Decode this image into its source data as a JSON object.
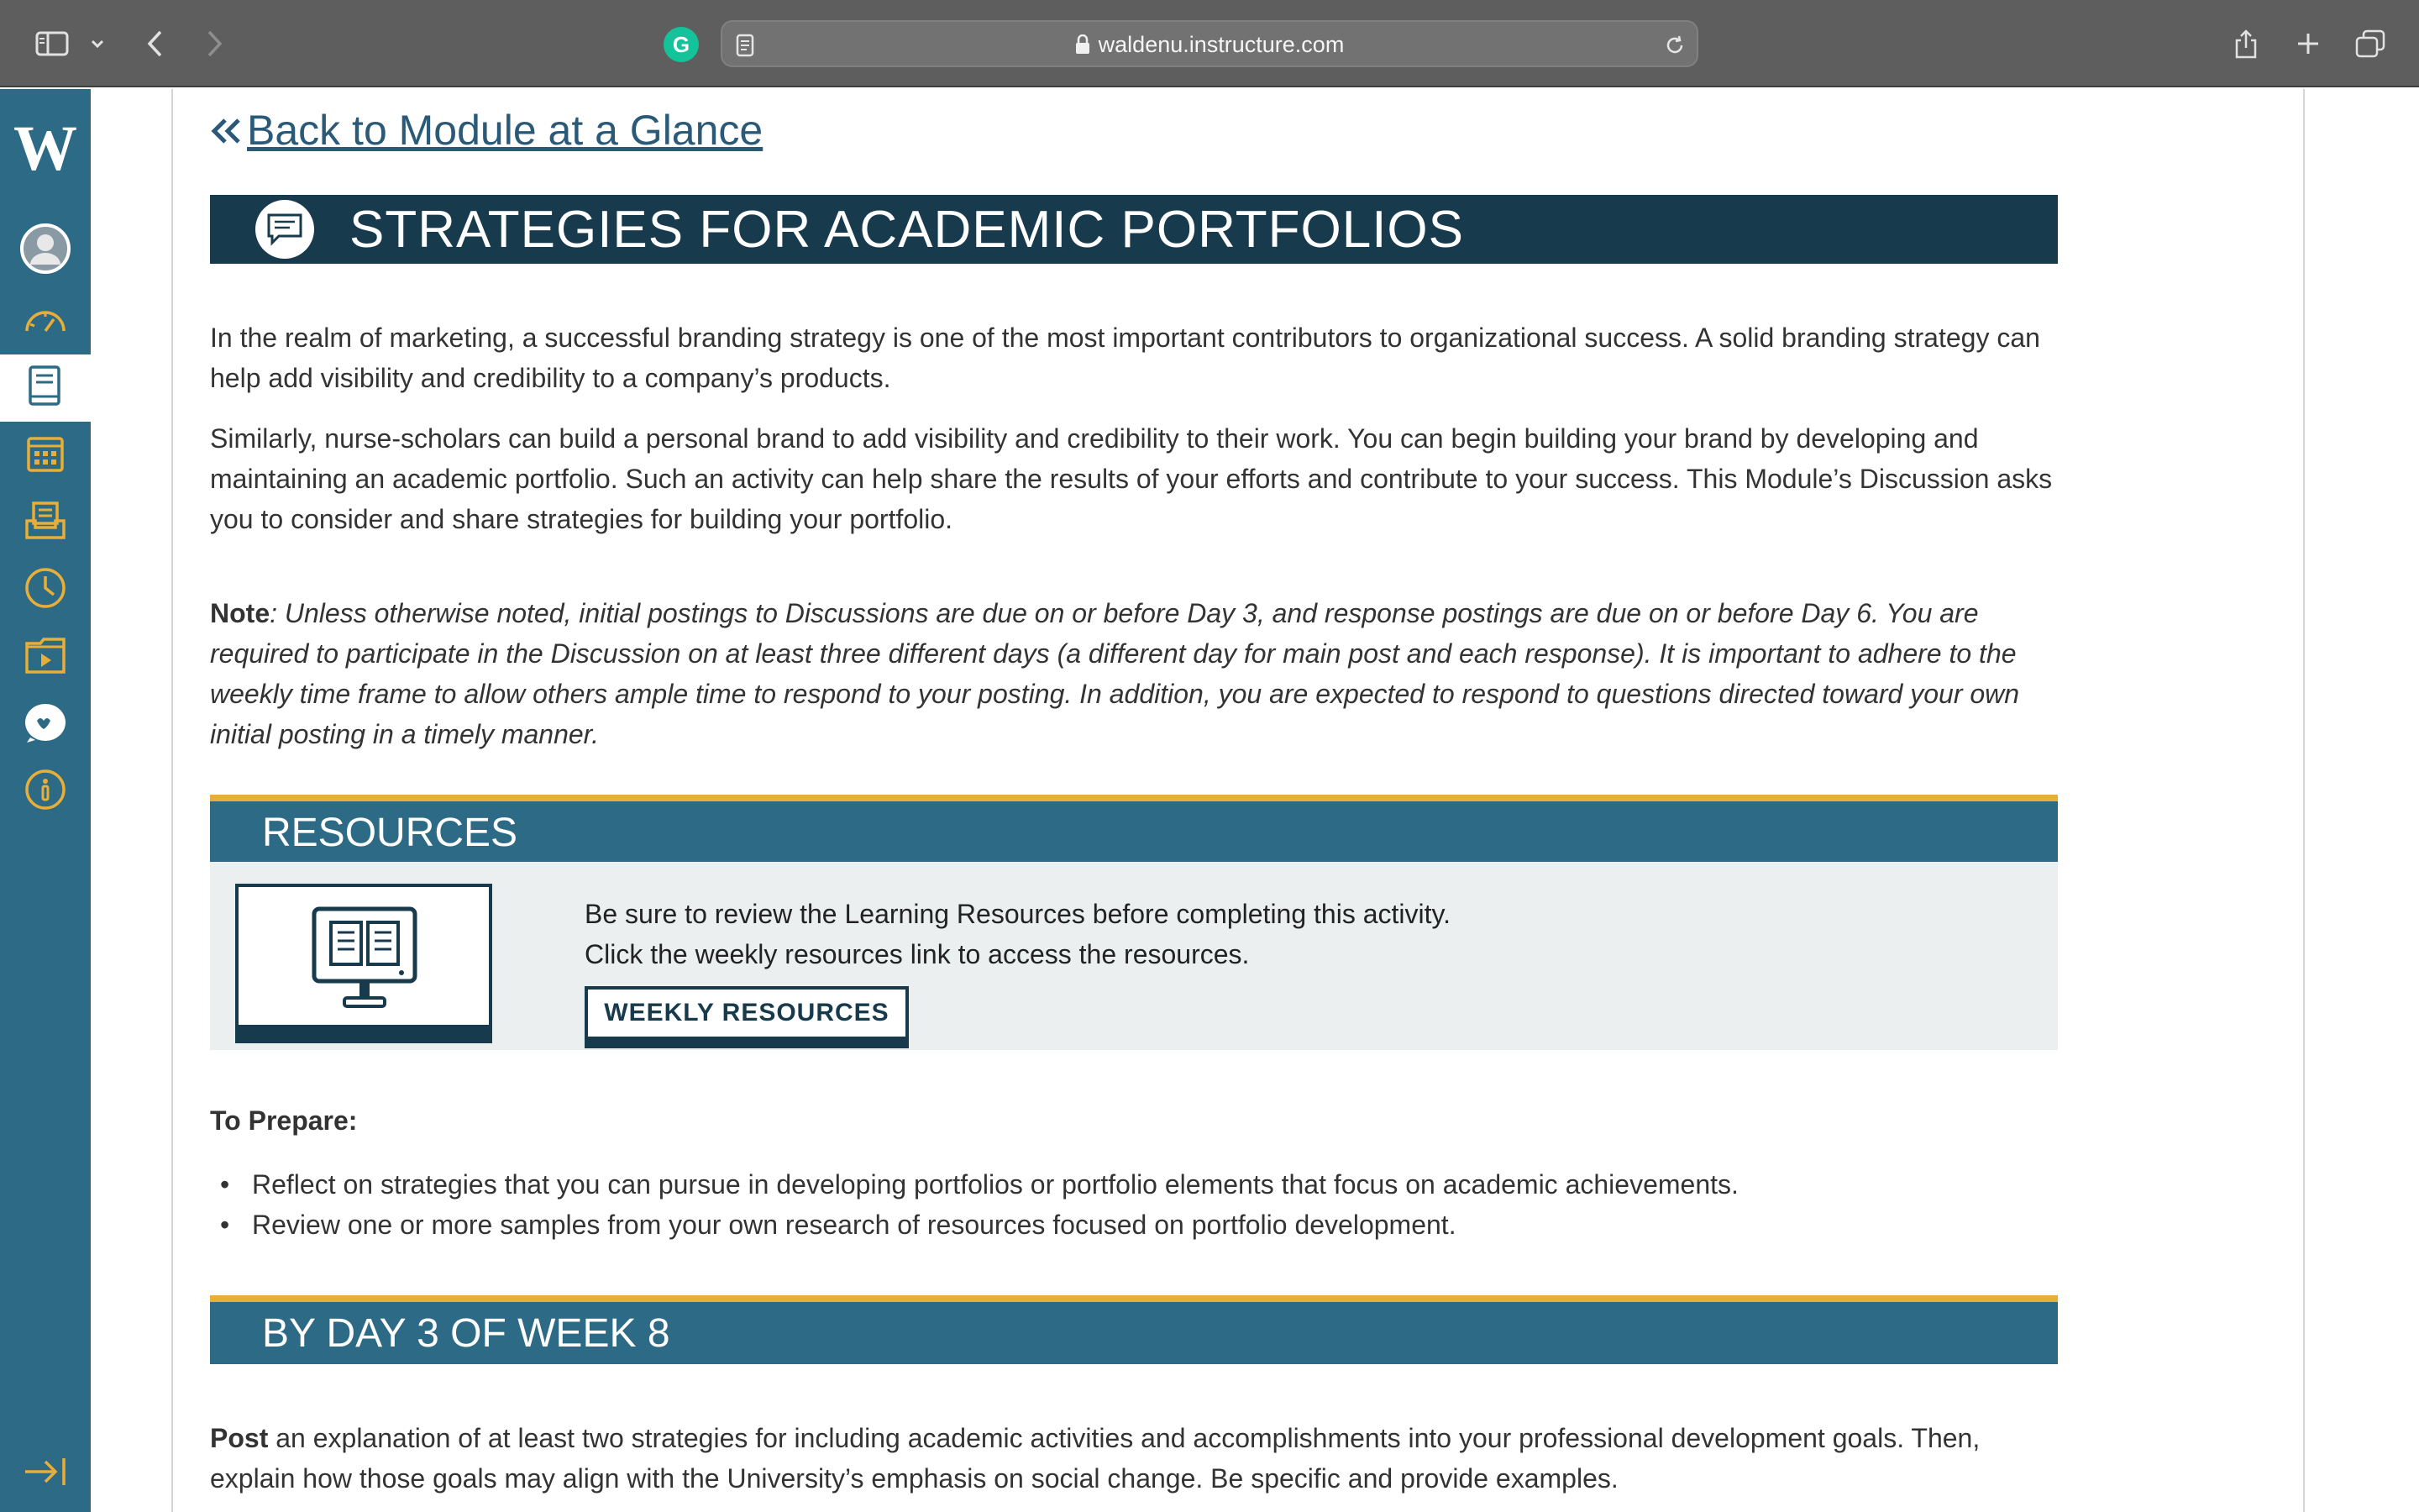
{
  "browser": {
    "url": "waldenu.instructure.com",
    "extension_icon": "G"
  },
  "nav": {
    "logo": "W",
    "items": [
      {
        "icon": "account-icon"
      },
      {
        "icon": "dashboard-icon"
      },
      {
        "icon": "courses-icon",
        "active": true
      },
      {
        "icon": "calendar-icon"
      },
      {
        "icon": "inbox-icon"
      },
      {
        "icon": "history-icon"
      },
      {
        "icon": "commons-icon"
      },
      {
        "icon": "support-icon"
      },
      {
        "icon": "help-icon"
      }
    ],
    "collapse_icon": "collapse-nav-icon"
  },
  "page": {
    "back_link": "Back to Module at a Glance",
    "title": "STRATEGIES FOR ACADEMIC PORTFOLIOS",
    "intro_p1": "In the realm of marketing, a successful branding strategy is one of the most important contributors to organizational success. A solid branding strategy can help add visibility and credibility to a company’s products.",
    "intro_p2": "Similarly, nurse-scholars can build a personal brand to add visibility and credibility to their work. You can begin building your brand by developing and maintaining an academic portfolio. Such an activity can help share the results of your efforts and contribute to your success. This Module’s Discussion asks you to consider and share strategies for building your portfolio.",
    "note_label": "Note",
    "note_text": ": Unless otherwise noted, initial postings to Discussions are due on or before Day 3, and response postings are due on or before Day 6. You are required to participate in the Discussion on at least three different days (a different day for main post and each response). It is important to adhere to the weekly time frame to allow others ample time to respond to your posting. In addition, you are expected to respond to questions directed toward your own initial posting in a timely manner.",
    "resources": {
      "heading": "RESOURCES",
      "line1": "Be sure to review the Learning Resources before completing this activity.",
      "line2": "Click the weekly resources link to access the resources.",
      "button": "WEEKLY RESOURCES"
    },
    "prepare": {
      "heading": "To Prepare:",
      "items": [
        "Reflect on strategies that you can pursue in developing portfolios or portfolio elements that focus on academic achievements.",
        "Review one or more samples from your own research of resources focused on portfolio development."
      ]
    },
    "day3": {
      "heading": "BY DAY 3 OF WEEK 8",
      "post_label": "Post",
      "post_text": " an explanation of at least two strategies for including academic activities and accomplishments into your professional development goals. Then, explain how those goals may align with the University’s emphasis on social change. Be specific and provide examples."
    }
  },
  "colors": {
    "nav": "#2d6a85",
    "banner_dark": "#183a4d",
    "banner": "#2d6a85",
    "accent": "#e8ae3a",
    "nav_icon": "#e8ae3a"
  }
}
